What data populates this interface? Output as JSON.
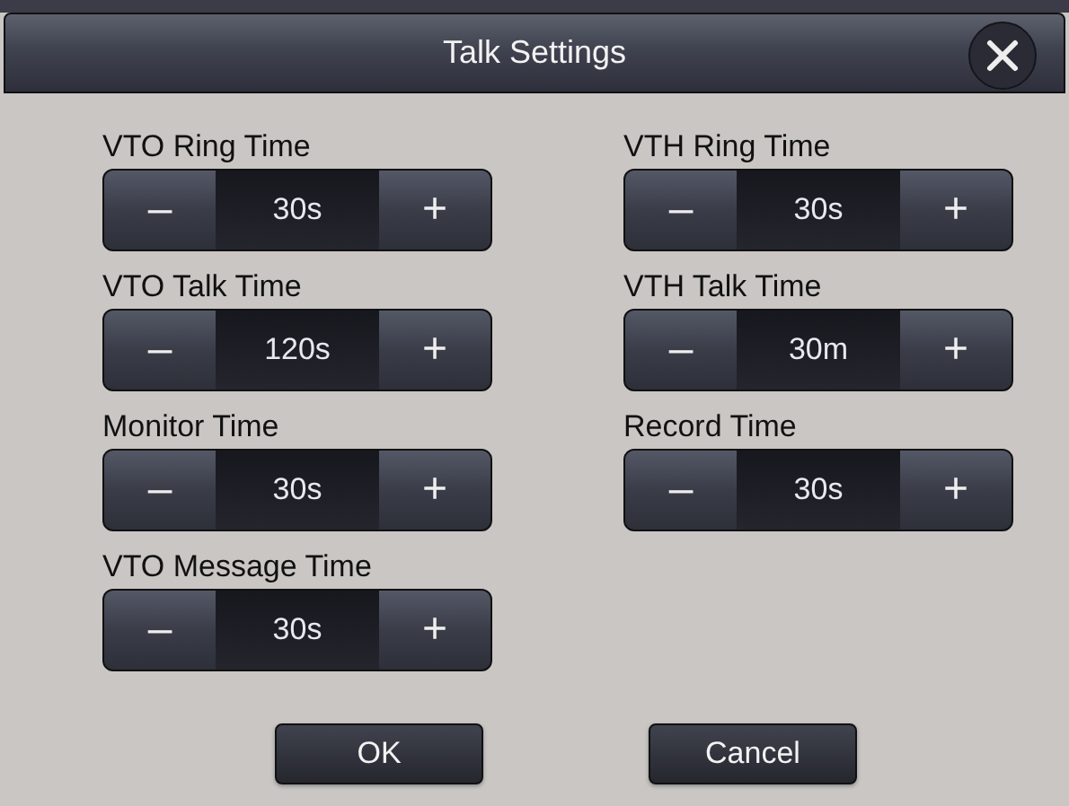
{
  "window": {
    "title": "Talk Settings"
  },
  "columns": [
    [
      {
        "label": "VTO Ring Time",
        "value": "30s",
        "decrement": "–",
        "increment": "+"
      },
      {
        "label": "VTO Talk Time",
        "value": "120s",
        "decrement": "–",
        "increment": "+"
      },
      {
        "label": "Monitor Time",
        "value": "30s",
        "decrement": "–",
        "increment": "+"
      },
      {
        "label": "VTO Message Time",
        "value": "30s",
        "decrement": "–",
        "increment": "+"
      }
    ],
    [
      {
        "label": "VTH Ring Time",
        "value": "30s",
        "decrement": "–",
        "increment": "+"
      },
      {
        "label": "VTH Talk Time",
        "value": "30m",
        "decrement": "–",
        "increment": "+"
      },
      {
        "label": "Record Time",
        "value": "30s",
        "decrement": "–",
        "increment": "+"
      }
    ]
  ],
  "buttons": [
    "OK",
    "Cancel"
  ]
}
